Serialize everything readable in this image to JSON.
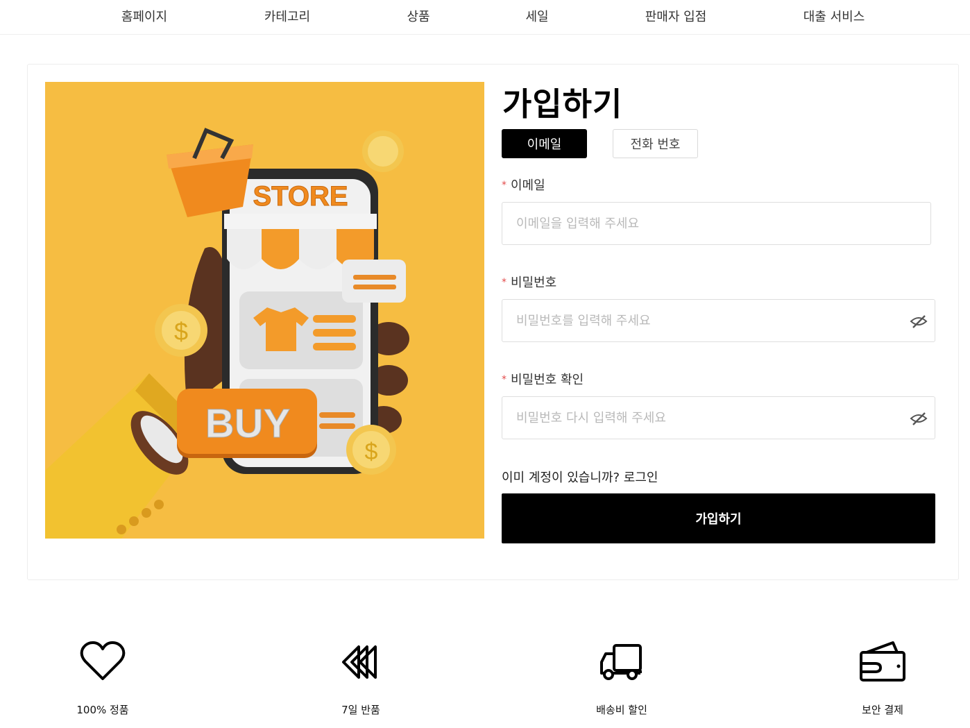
{
  "nav": {
    "items": [
      "홈페이지",
      "카테고리",
      "상품",
      "세일",
      "판매자 입점",
      "대출 서비스"
    ]
  },
  "hero": {
    "store_text": "STORE",
    "buy_text": "BUY",
    "bg_color": "#f6bd42"
  },
  "signup": {
    "title": "가입하기",
    "tabs": [
      "이메일",
      "전화 번호"
    ],
    "email": {
      "label": "이메일",
      "placeholder": "이메일을 입력해 주세요"
    },
    "password": {
      "label": "비밀번호",
      "placeholder": "비밀번호를 입력해 주세요"
    },
    "password_confirm": {
      "label": "비밀번호 확인",
      "placeholder": "비밀번호 다시 입력해 주세요"
    },
    "required_mark": "*",
    "login_prompt": "이미 계정이 있습니까? 로그인",
    "submit_label": "가입하기"
  },
  "features": [
    {
      "icon": "heart-icon",
      "label": "100% 정품"
    },
    {
      "icon": "rewind-icon",
      "label": "7일 반품"
    },
    {
      "icon": "truck-icon",
      "label": "배송비 할인"
    },
    {
      "icon": "wallet-icon",
      "label": "보안 결제"
    }
  ],
  "colors": {
    "accent": "#000000",
    "required": "#e34b4b",
    "border": "#dedede"
  }
}
